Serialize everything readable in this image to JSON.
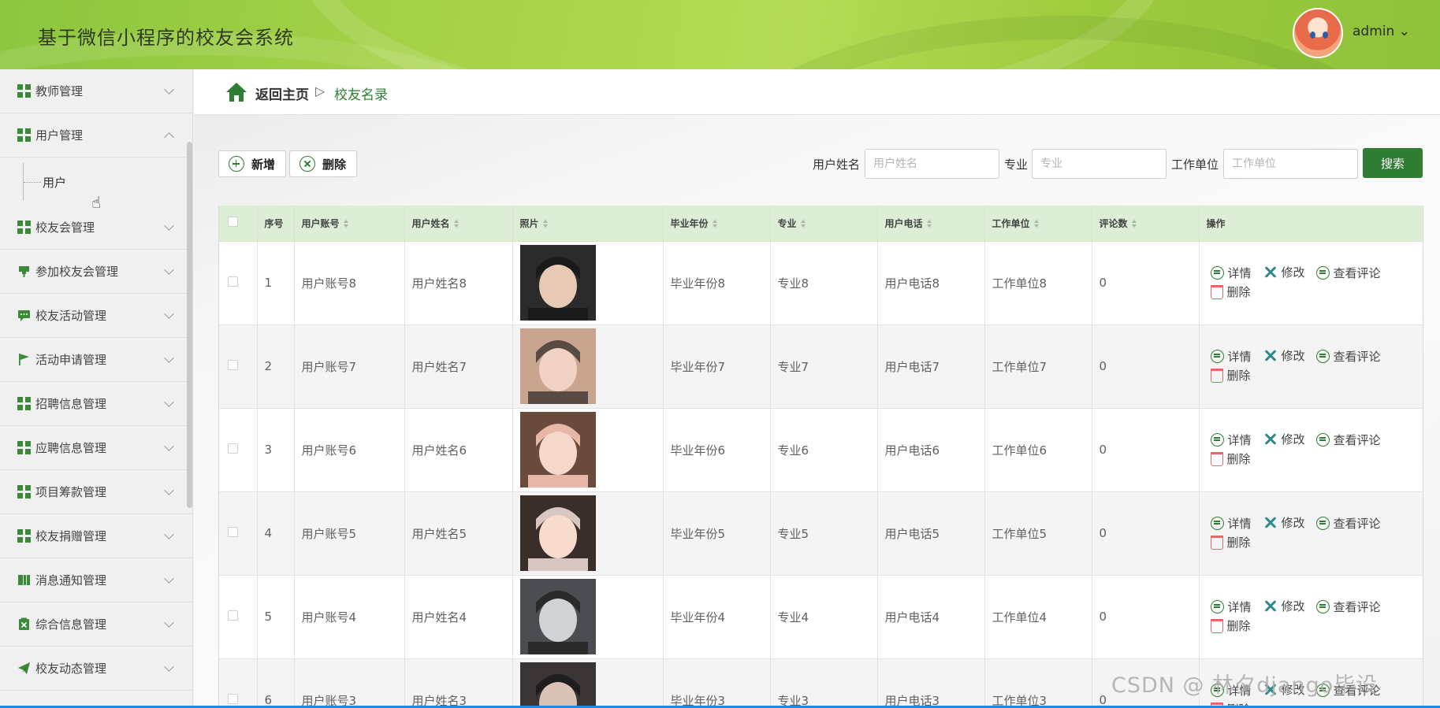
{
  "app": {
    "title": "基于微信小程序的校友会系统",
    "user": "admin ⌄"
  },
  "sidebar": {
    "items": [
      {
        "label": "教师管理",
        "icon": "grid-icon",
        "expanded": false
      },
      {
        "label": "用户管理",
        "icon": "grid-icon",
        "expanded": true
      },
      {
        "label": "校友会管理",
        "icon": "grid-icon",
        "expanded": false
      },
      {
        "label": "参加校友会管理",
        "icon": "pin-icon",
        "expanded": false
      },
      {
        "label": "校友活动管理",
        "icon": "chat-icon",
        "expanded": false
      },
      {
        "label": "活动申请管理",
        "icon": "flag-icon",
        "expanded": false
      },
      {
        "label": "招聘信息管理",
        "icon": "grid-icon",
        "expanded": false
      },
      {
        "label": "应聘信息管理",
        "icon": "grid-icon",
        "expanded": false
      },
      {
        "label": "项目筹款管理",
        "icon": "grid-icon",
        "expanded": false
      },
      {
        "label": "校友捐赠管理",
        "icon": "grid-icon",
        "expanded": false
      },
      {
        "label": "消息通知管理",
        "icon": "book-icon",
        "expanded": false
      },
      {
        "label": "综合信息管理",
        "icon": "clipboard-icon",
        "expanded": false
      },
      {
        "label": "校友动态管理",
        "icon": "send-icon",
        "expanded": false
      }
    ],
    "sub_item": "用户"
  },
  "breadcrumb": {
    "home": "返回主页",
    "separator": "▷",
    "current": "校友名录"
  },
  "toolbar": {
    "add_label": "新增",
    "delete_label": "删除",
    "search_label": "搜索"
  },
  "filters": {
    "name_label": "用户姓名",
    "name_placeholder": "用户姓名",
    "major_label": "专业",
    "major_placeholder": "专业",
    "work_label": "工作单位",
    "work_placeholder": "工作单位"
  },
  "table": {
    "headers": [
      "序号",
      "用户账号",
      "用户姓名",
      "照片",
      "毕业年份",
      "专业",
      "用户电话",
      "工作单位",
      "评论数",
      "操作"
    ],
    "actions": {
      "detail": "详情",
      "edit": "修改",
      "comments": "查看评论",
      "delete": "删除"
    },
    "rows": [
      {
        "no": "1",
        "account": "用户账号8",
        "name": "用户姓名8",
        "year": "毕业年份8",
        "major": "专业8",
        "phone": "用户电话8",
        "work": "工作单位8",
        "comments": "0"
      },
      {
        "no": "2",
        "account": "用户账号7",
        "name": "用户姓名7",
        "year": "毕业年份7",
        "major": "专业7",
        "phone": "用户电话7",
        "work": "工作单位7",
        "comments": "0"
      },
      {
        "no": "3",
        "account": "用户账号6",
        "name": "用户姓名6",
        "year": "毕业年份6",
        "major": "专业6",
        "phone": "用户电话6",
        "work": "工作单位6",
        "comments": "0"
      },
      {
        "no": "4",
        "account": "用户账号5",
        "name": "用户姓名5",
        "year": "毕业年份5",
        "major": "专业5",
        "phone": "用户电话5",
        "work": "工作单位5",
        "comments": "0"
      },
      {
        "no": "5",
        "account": "用户账号4",
        "name": "用户姓名4",
        "year": "毕业年份4",
        "major": "专业4",
        "phone": "用户电话4",
        "work": "工作单位4",
        "comments": "0"
      },
      {
        "no": "6",
        "account": "用户账号3",
        "name": "用户姓名3",
        "year": "毕业年份3",
        "major": "专业3",
        "phone": "用户电话3",
        "work": "工作单位3",
        "comments": "0"
      }
    ]
  },
  "watermark": "CSDN @ 林夕django毕设",
  "colors": {
    "primary": "#2e7d32",
    "header": "#a6d247",
    "table_header": "#dcefd6"
  }
}
